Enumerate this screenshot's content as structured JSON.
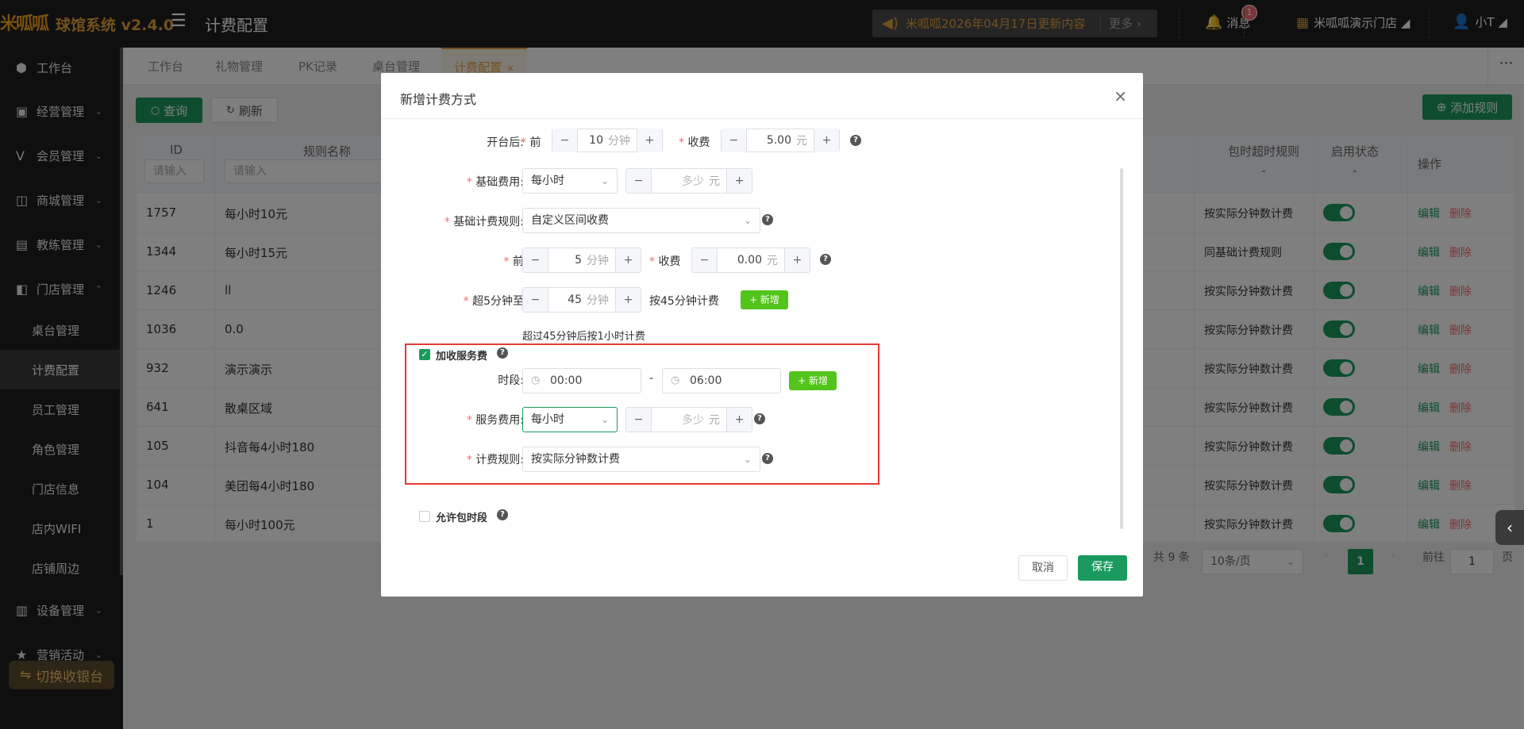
{
  "topbar": {
    "logo": "米呱呱",
    "app_title": "球馆系统 v2.4.0",
    "page_title": "计费配置",
    "notice_text": "米呱呱2026年04月17日更新内容",
    "notice_more": "更多 ›",
    "messages_label": "消息",
    "messages_count": "1",
    "store_label": "米呱呱演示门店 ◢",
    "user_label": "小T ◢"
  },
  "sidebar": {
    "items": [
      {
        "label": "工作台",
        "icon": "cube-icon"
      },
      {
        "label": "经营管理",
        "icon": "chart-icon"
      },
      {
        "label": "会员管理",
        "icon": "vip-icon"
      },
      {
        "label": "商城管理",
        "icon": "bag-icon"
      },
      {
        "label": "教练管理",
        "icon": "coach-icon"
      },
      {
        "label": "门店管理",
        "icon": "store-icon"
      },
      {
        "label": "设备管理",
        "icon": "device-icon"
      },
      {
        "label": "营销活动",
        "icon": "star-icon"
      }
    ],
    "sub_items": [
      "桌台管理",
      "计费配置",
      "员工管理",
      "角色管理",
      "门店信息",
      "店内WIFI",
      "店铺周边"
    ],
    "switch_label": "切换收银台"
  },
  "tabs": [
    "工作台",
    "礼物管理",
    "PK记录",
    "桌台管理",
    "计费配置"
  ],
  "toolbar": {
    "query": "查询",
    "refresh": "刷新",
    "add_rule": "添加规则"
  },
  "table": {
    "headers": {
      "id": "ID",
      "name": "规则名称",
      "overtime": "包时超时规则",
      "overtime_sub": "-",
      "status": "启用状态",
      "status_sub": "-",
      "ops": "操作"
    },
    "id_placeholder": "请输入",
    "name_placeholder": "请输入",
    "rows": [
      {
        "id": "1757",
        "name": "每小时10元",
        "overtime": "按实际分钟数计费"
      },
      {
        "id": "1344",
        "name": "每小时15元",
        "overtime": "同基础计费规则"
      },
      {
        "id": "1246",
        "name": "ll",
        "overtime": "按实际分钟数计费"
      },
      {
        "id": "1036",
        "name": "0.0",
        "overtime": "按实际分钟数计费"
      },
      {
        "id": "932",
        "name": "演示演示",
        "overtime": "按实际分钟数计费"
      },
      {
        "id": "641",
        "name": "散桌区域",
        "overtime": "按实际分钟数计费"
      },
      {
        "id": "105",
        "name": "抖音每4小时180",
        "overtime": "按实际分钟数计费"
      },
      {
        "id": "104",
        "name": "美团每4小时180",
        "overtime": "按实际分钟数计费"
      },
      {
        "id": "1",
        "name": "每小时100元",
        "overtime": "按实际分钟数计费"
      }
    ],
    "edit": "编辑",
    "delete": "删除"
  },
  "pager": {
    "total": "共 9 条",
    "size": "10条/页",
    "page": "1",
    "goto": "前往",
    "goto_value": "1",
    "page_unit": "页"
  },
  "dialog": {
    "title": "新增计费方式",
    "open_label": "开台后:",
    "before": "前",
    "open_minutes": "10",
    "minute_unit": "分钟",
    "charge": "收费",
    "open_fee": "5.00",
    "yuan": "元",
    "base_fee_label": "基础费用:",
    "per_hour": "每小时",
    "amount_ph": "多少",
    "base_rule_label": "基础计费规则:",
    "base_rule_value": "自定义区间收费",
    "range_before": "前",
    "range_minutes": "5",
    "range_fee": "0.00",
    "over_label": "超5分钟至",
    "over_minutes": "45",
    "over_text": "按45分钟计费",
    "add_new": "+ 新增",
    "over_note": "超过45分钟后按1小时计费",
    "service_fee_check": "加收服务费",
    "period_label": "时段:",
    "time_start": "00:00",
    "time_dash": "-",
    "time_end": "06:00",
    "service_fee_label": "服务费用:",
    "billing_rule_label": "计费规则:",
    "billing_rule_value": "按实际分钟数计费",
    "allow_package": "允许包时段",
    "cancel": "取消",
    "save": "保存"
  },
  "colors": {
    "accent": "#1a9a5c",
    "danger": "#f56c6c",
    "brand": "#e6a23c",
    "highlight": "#e53935"
  }
}
